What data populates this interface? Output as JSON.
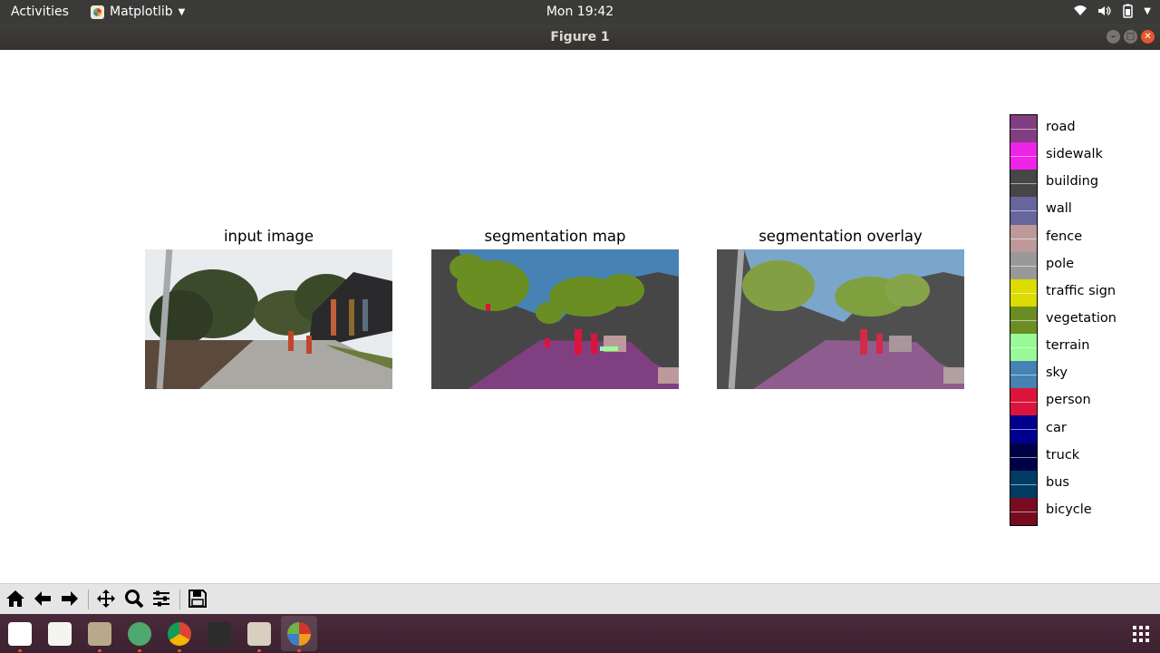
{
  "topbar": {
    "activities": "Activities",
    "app_name": "Matplotlib",
    "clock": "Mon 19:42"
  },
  "window": {
    "title": "Figure 1"
  },
  "figure": {
    "panels": [
      {
        "title": "input image"
      },
      {
        "title": "segmentation map"
      },
      {
        "title": "segmentation overlay"
      }
    ],
    "legend": [
      {
        "label": "road",
        "color": "#803f80"
      },
      {
        "label": "sidewalk",
        "color": "#f023e8"
      },
      {
        "label": "building",
        "color": "#464646"
      },
      {
        "label": "wall",
        "color": "#66669c"
      },
      {
        "label": "fence",
        "color": "#be9999"
      },
      {
        "label": "pole",
        "color": "#999999"
      },
      {
        "label": "traffic sign",
        "color": "#dcdc00"
      },
      {
        "label": "vegetation",
        "color": "#6b8e23"
      },
      {
        "label": "terrain",
        "color": "#98fb98"
      },
      {
        "label": "sky",
        "color": "#4682b4"
      },
      {
        "label": "person",
        "color": "#dc143c"
      },
      {
        "label": "car",
        "color": "#00008e"
      },
      {
        "label": "truck",
        "color": "#000046"
      },
      {
        "label": "bus",
        "color": "#003c64"
      },
      {
        "label": "bicycle",
        "color": "#770b20"
      }
    ]
  },
  "toolbar": {
    "buttons": [
      {
        "name": "home-icon",
        "glyph": "⌂"
      },
      {
        "name": "back-icon",
        "glyph": "←"
      },
      {
        "name": "forward-icon",
        "glyph": "→"
      },
      {
        "name": "pan-icon",
        "glyph": "✥"
      },
      {
        "name": "zoom-icon",
        "glyph": "🔍"
      },
      {
        "name": "configure-subplots-icon",
        "glyph": "☰"
      },
      {
        "name": "save-icon",
        "glyph": "💾"
      }
    ]
  },
  "dock": {
    "apps": [
      {
        "name": "photo-app-icon",
        "color": "#ffffff"
      },
      {
        "name": "text-editor-icon",
        "color": "#f5f5f0"
      },
      {
        "name": "files-icon",
        "color": "#b9a88a"
      },
      {
        "name": "atom-icon",
        "color": "#4fa86e"
      },
      {
        "name": "chrome-icon",
        "color": "#4285f4"
      },
      {
        "name": "terminal-icon",
        "color": "#2c2c2c"
      },
      {
        "name": "image-viewer-icon",
        "color": "#d8cfc0"
      },
      {
        "name": "matplotlib-icon",
        "color": "#f2e7d3"
      }
    ]
  }
}
